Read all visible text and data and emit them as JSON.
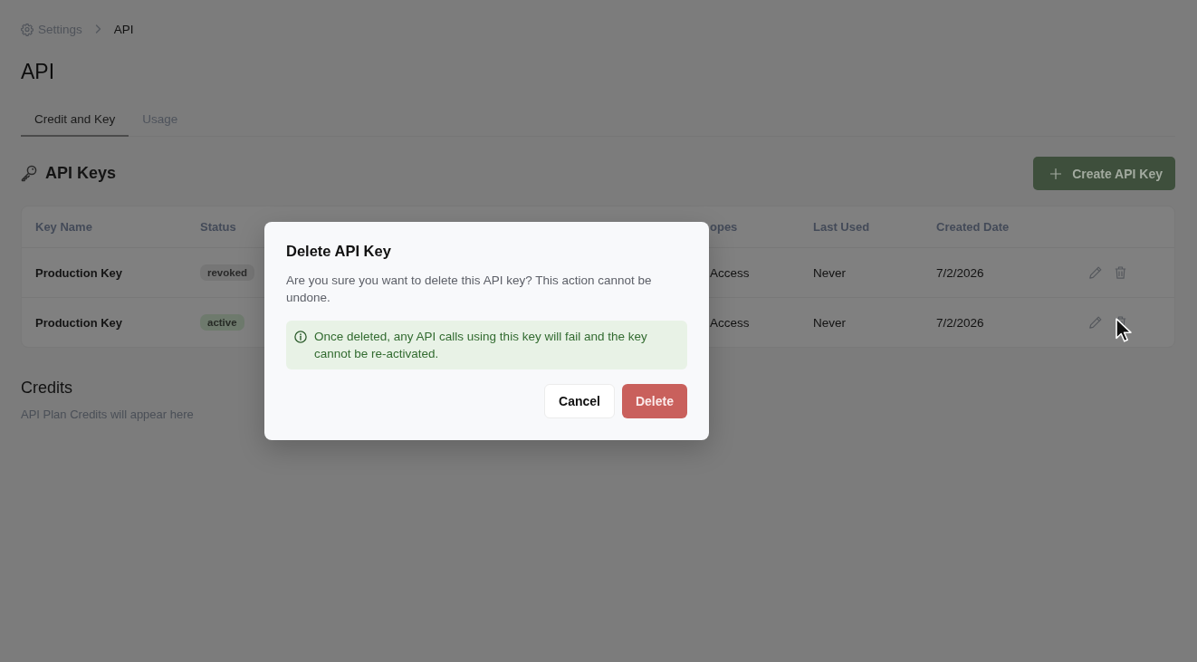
{
  "breadcrumb": [
    {
      "label": "Settings",
      "kind": "link"
    },
    {
      "label": "API",
      "kind": "current"
    }
  ],
  "page_title": "API",
  "tabs": [
    {
      "label": "Credit and Key",
      "selected": true
    },
    {
      "label": "Usage",
      "selected": false
    }
  ],
  "api_keys": {
    "title": "API Keys",
    "create_button": "Create API Key",
    "table": {
      "columns": [
        "Key Name",
        "Status",
        "opes",
        "Last Used",
        "Created Date"
      ],
      "rows": [
        {
          "key_name": "Production Key",
          "status": {
            "label": "revoked",
            "color": "#767676"
          },
          "column_3": "Access",
          "last_used": "Never",
          "created_date": "7/2/2026"
        },
        {
          "key_name": "Production Key",
          "status": {
            "label": "active",
            "color": "#6e7a6d"
          },
          "column_3": "Access",
          "last_used": "Never",
          "created_date": "7/2/2026"
        }
      ]
    }
  },
  "credits": {
    "title": "Credits",
    "text": "API Plan Credits will appear here"
  },
  "dialog": {
    "title": "Delete API Key",
    "message": "Are you sure you want to delete this API key? This action cannot be undone.",
    "notice": "Once deleted, any API calls using this key will fail and the key cannot be re-activated.",
    "buttons": [
      {
        "label": "Cancel",
        "kind": "secondary"
      },
      {
        "label": "Delete",
        "kind": "danger"
      }
    ]
  }
}
